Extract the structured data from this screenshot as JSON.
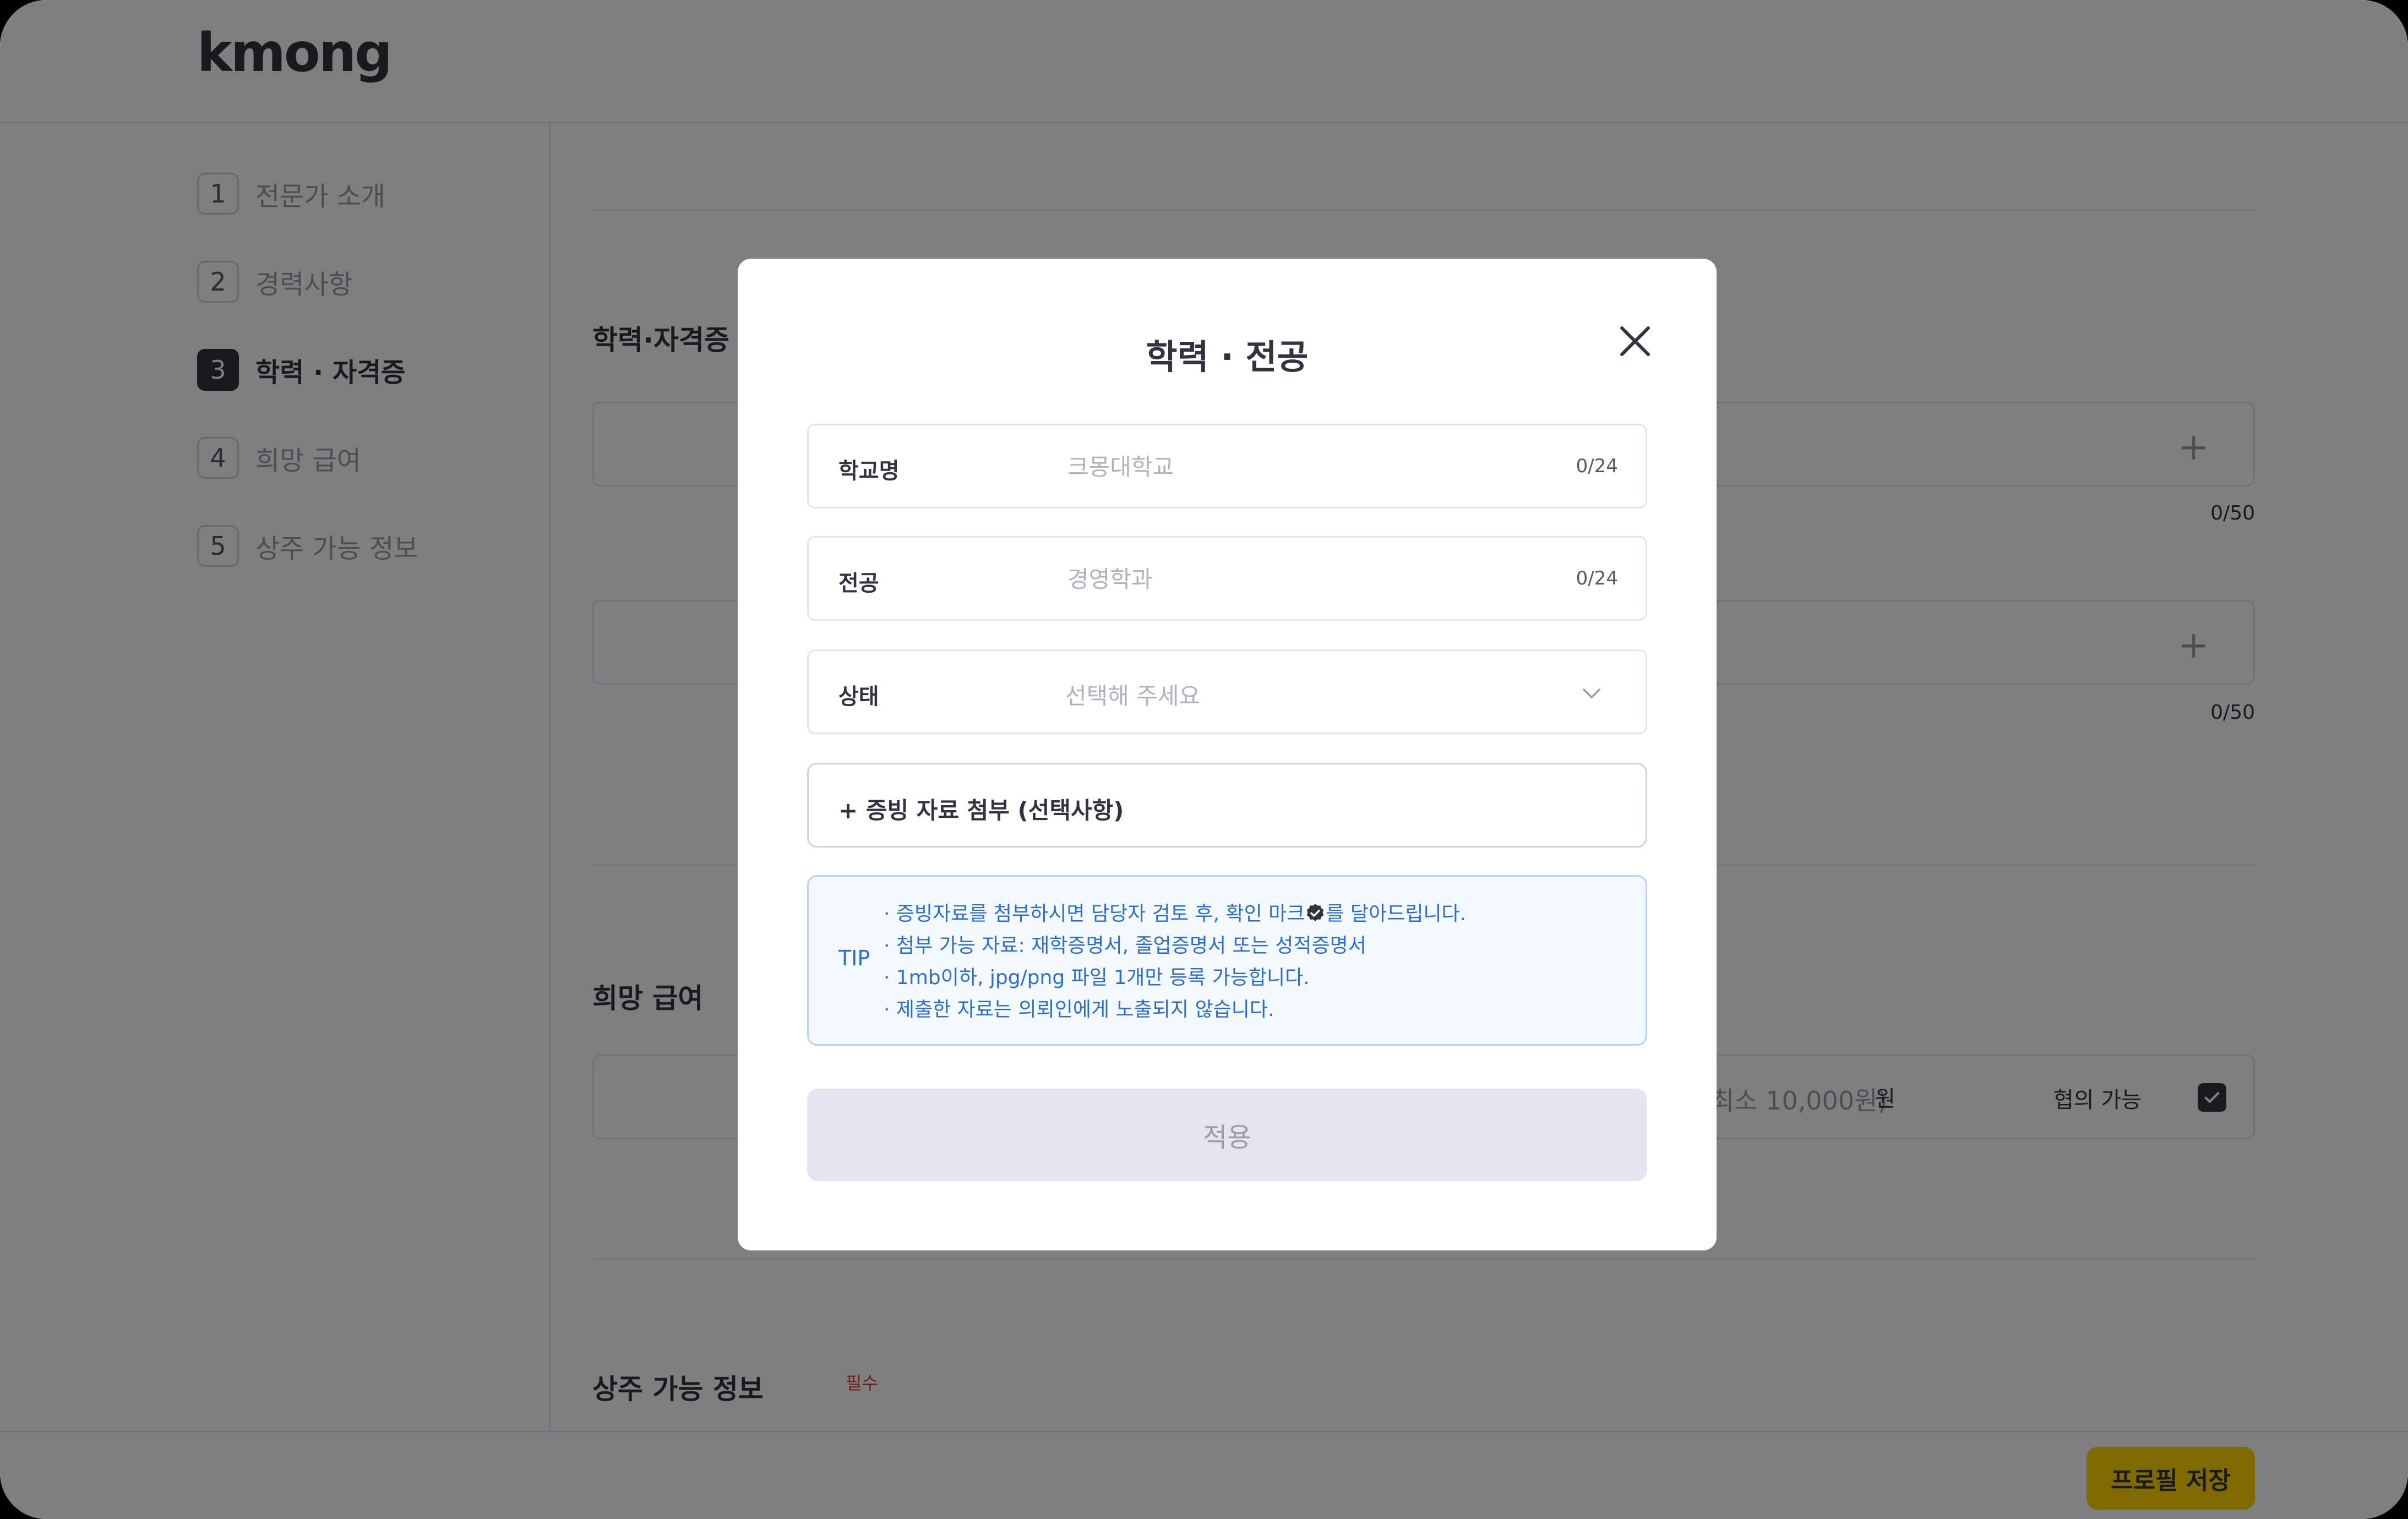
{
  "header": {
    "logo_text": "kmong"
  },
  "sidebar": {
    "steps": [
      {
        "num": "1",
        "label": "전문가 소개"
      },
      {
        "num": "2",
        "label": "경력사항"
      },
      {
        "num": "3",
        "label": "학력 · 자격증"
      },
      {
        "num": "4",
        "label": "희망 급여"
      },
      {
        "num": "5",
        "label": "상주 가능 정보"
      }
    ],
    "active_index": 2
  },
  "main": {
    "section_education": {
      "title": "학력·자격증",
      "count_1": "0/50",
      "count_2": "0/50"
    },
    "section_salary": {
      "title": "희망 급여",
      "min_hint": "(최소 10,000원)",
      "unit": "원",
      "negotiable_label": "협의 가능",
      "negotiable_checked": true
    },
    "section_residency": {
      "title": "상주 가능 정보",
      "required_label": "필수"
    }
  },
  "footer": {
    "save_label": "프로필 저장"
  },
  "modal": {
    "title": "학력 · 전공",
    "fields": {
      "school": {
        "label": "학교명",
        "placeholder": "크몽대학교",
        "value": "",
        "count": "0/24"
      },
      "major": {
        "label": "전공",
        "placeholder": "경영학과",
        "value": "",
        "count": "0/24"
      },
      "status": {
        "label": "상태",
        "selected": "선택해 주세요"
      }
    },
    "attach_label": "+ 증빙 자료 첨부 (선택사항)",
    "tip": {
      "label": "TIP",
      "line_1_prefix": "· 증빙자료를 첨부하시면 담당자 검토 후, 확인 마크",
      "line_1_suffix": "를 달아드립니다.",
      "line_2": "· 첨부 가능 자료: 재학증명서, 졸업증명서 또는 성적증명서",
      "line_3": "· 1mb이하, jpg/png 파일 1개만 등록 가능합니다.",
      "line_4": "· 제출한 자료는 의뢰인에게 노출되지 않습니다."
    },
    "apply_label": "적용"
  },
  "colors": {
    "brand_yellow": "#ffd400",
    "text_dark": "#303441",
    "tip_blue": "#2c6ecb",
    "tip_bg": "#f4f9ff",
    "overlay": "rgba(0,0,0,0.5)"
  },
  "icons": {
    "close": "close-icon",
    "chevron": "chevron-down-icon",
    "plus": "plus-icon",
    "verified": "verified-check-icon",
    "checkbox": "check-icon"
  }
}
